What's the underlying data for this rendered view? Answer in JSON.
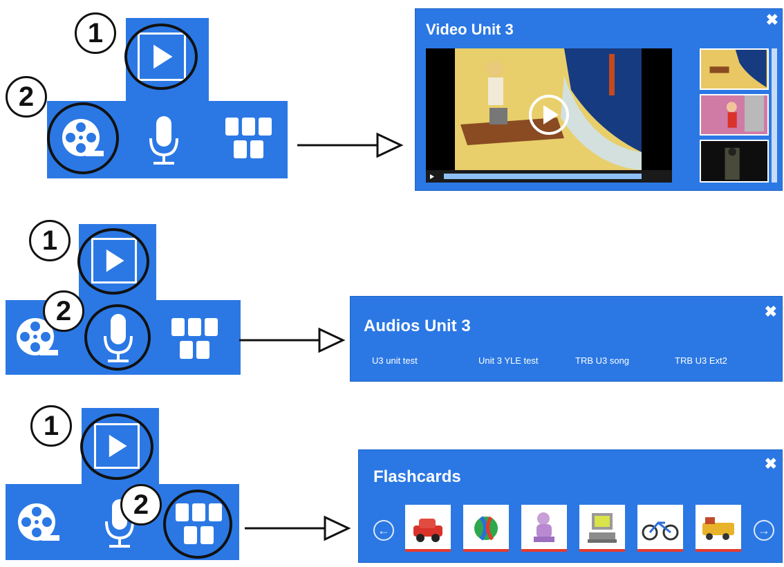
{
  "colors": {
    "panel_blue": "#2b78e4",
    "arrow": "#111111"
  },
  "markers": {
    "one": "1",
    "two": "2"
  },
  "icons": [
    "play-icon",
    "film-reel-icon",
    "microphone-icon",
    "grid-icon"
  ],
  "video_panel": {
    "title": "Video Unit 3",
    "close": "✖"
  },
  "audio_panel": {
    "title": "Audios Unit 3",
    "close": "✖",
    "tracks": [
      "U3 unit test",
      "Unit 3 YLE test",
      "TRB U3 song",
      "TRB U3 Ext2"
    ]
  },
  "flash_panel": {
    "title": "Flashcards",
    "close": "✖",
    "cards": [
      "car",
      "ball",
      "doll",
      "computer",
      "bike",
      "train"
    ]
  }
}
